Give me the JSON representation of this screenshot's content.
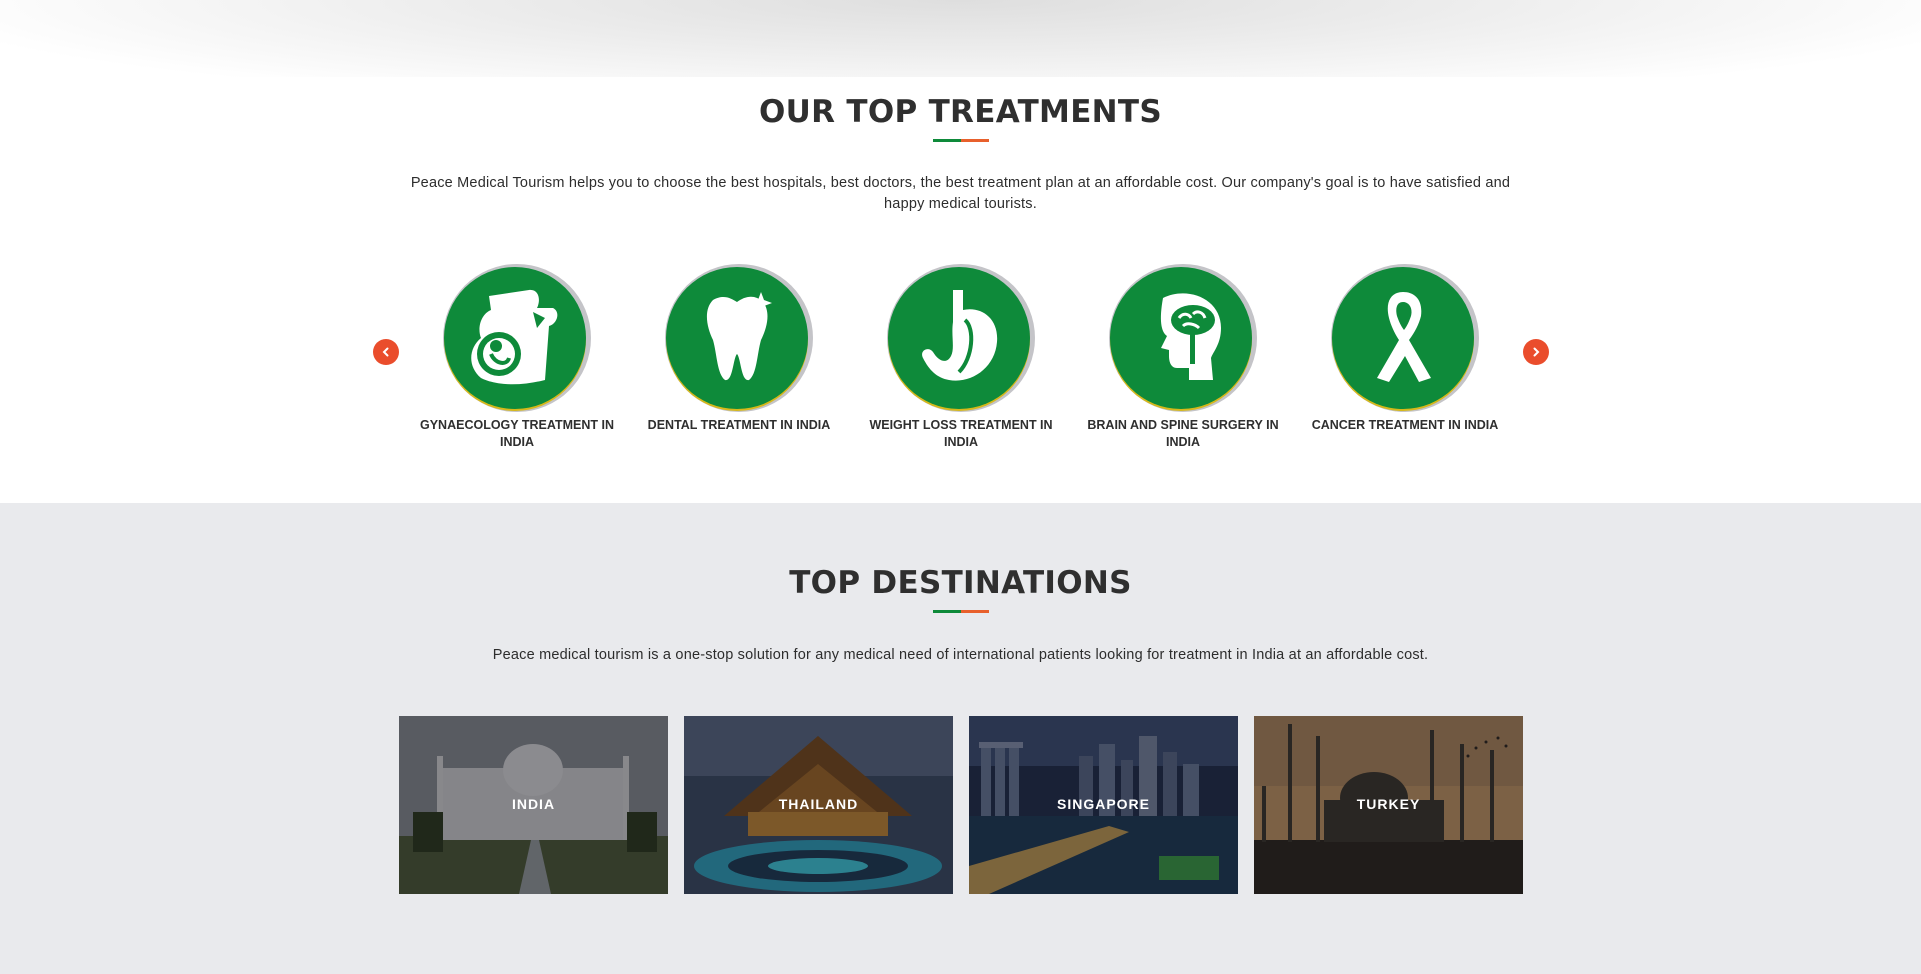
{
  "treatments": {
    "title": "OUR TOP TREATMENTS",
    "description": "Peace Medical Tourism helps you to choose the best hospitals, best doctors, the best treatment plan at an affordable cost. Our company's goal is to have satisfied and happy medical tourists.",
    "items": [
      {
        "label": "GYNAECOLOGY TREATMENT IN INDIA",
        "icon": "pregnancy-icon"
      },
      {
        "label": "DENTAL TREATMENT IN INDIA",
        "icon": "tooth-icon"
      },
      {
        "label": "WEIGHT LOSS TREATMENT IN INDIA",
        "icon": "stomach-icon"
      },
      {
        "label": "BRAIN AND SPINE SURGERY IN INDIA",
        "icon": "brain-head-icon"
      },
      {
        "label": "CANCER TREATMENT IN INDIA",
        "icon": "ribbon-icon"
      }
    ],
    "prev_icon": "chevron-left-icon",
    "next_icon": "chevron-right-icon"
  },
  "destinations": {
    "title": "TOP DESTINATIONS",
    "description": "Peace medical tourism is a one-stop solution for any medical need of international patients looking for treatment in India at an affordable cost.",
    "items": [
      {
        "name": "INDIA"
      },
      {
        "name": "THAILAND"
      },
      {
        "name": "SINGAPORE"
      },
      {
        "name": "TURKEY"
      }
    ]
  },
  "colors": {
    "brand_green": "#0e8a3a",
    "accent_orange": "#e8602c",
    "arrow_red": "#ea4d2c",
    "section_gray": "#e9eaed"
  }
}
